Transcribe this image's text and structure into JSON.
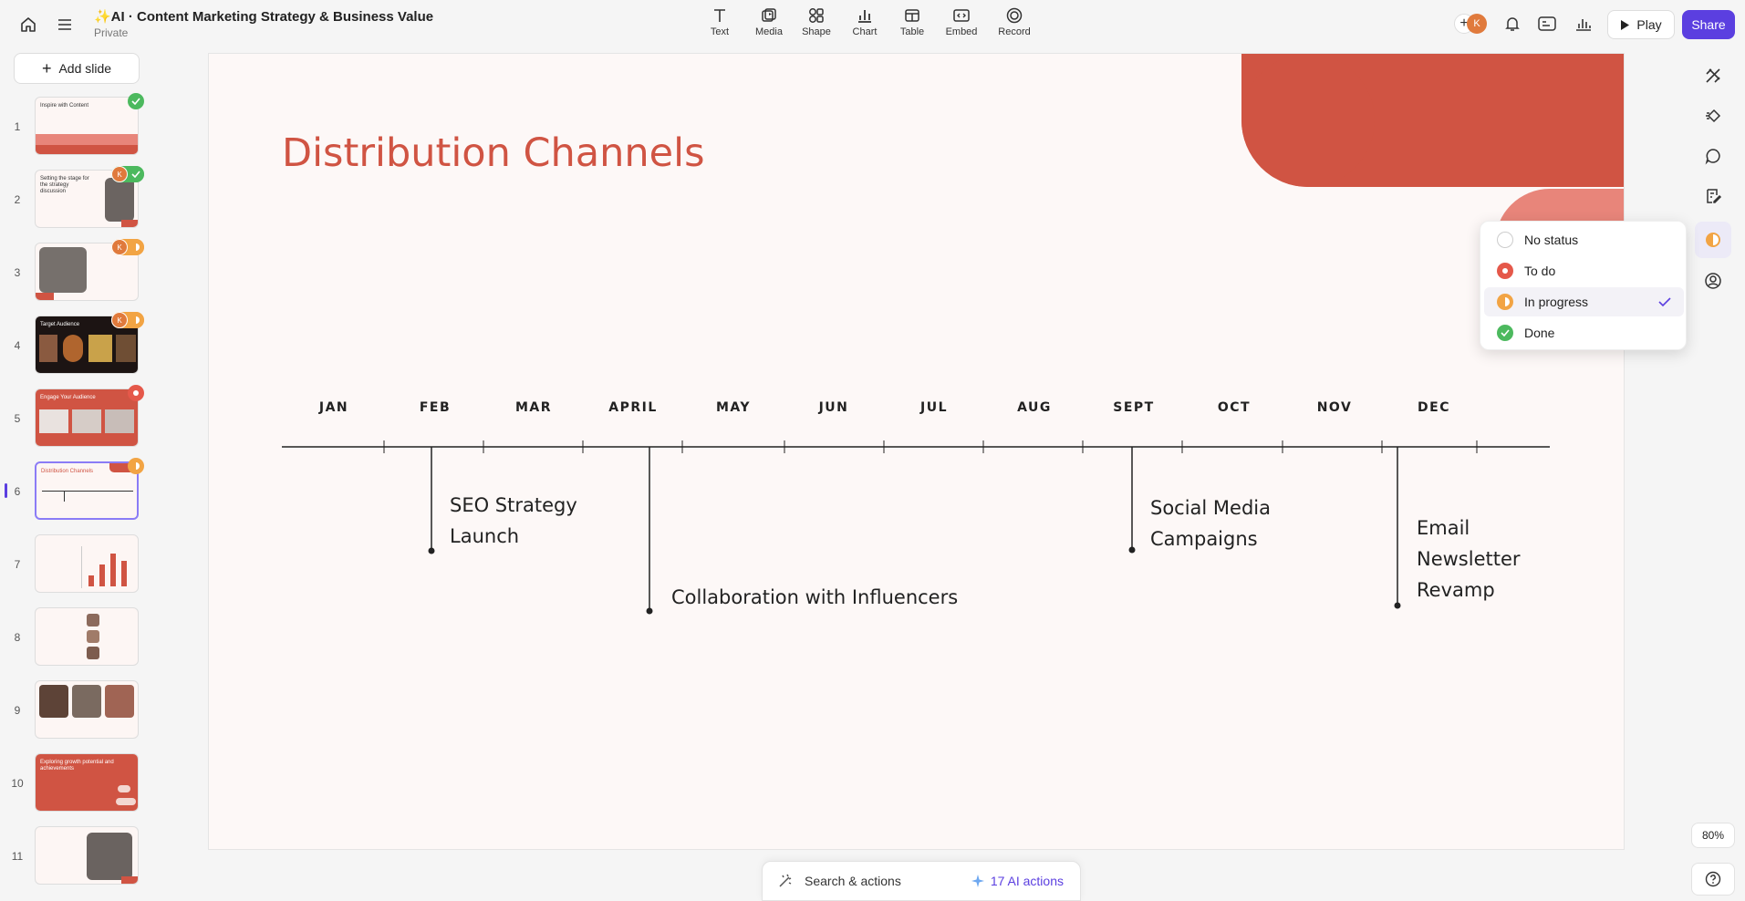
{
  "doc": {
    "title": "✨AI · Content Marketing Strategy & Business Value",
    "visibility": "Private"
  },
  "toolbar": {
    "tools": [
      {
        "label": "Text",
        "icon": "text-icon"
      },
      {
        "label": "Media",
        "icon": "media-icon"
      },
      {
        "label": "Shape",
        "icon": "shape-icon"
      },
      {
        "label": "Chart",
        "icon": "chart-icon"
      },
      {
        "label": "Table",
        "icon": "table-icon"
      },
      {
        "label": "Embed",
        "icon": "embed-icon"
      },
      {
        "label": "Record",
        "icon": "record-icon"
      }
    ],
    "play_label": "Play",
    "share_label": "Share",
    "collaborator_initial": "K"
  },
  "sidebar": {
    "add_slide_label": "Add slide",
    "active_slide": 6,
    "slides": [
      {
        "num": "1",
        "status": "done",
        "avatar": "",
        "title": "Inspire with Content"
      },
      {
        "num": "2",
        "status": "done",
        "avatar": "K",
        "title": "Setting the stage for the strategy discussion"
      },
      {
        "num": "3",
        "status": "in-progress",
        "avatar": "K",
        "title": ""
      },
      {
        "num": "4",
        "status": "in-progress",
        "avatar": "K",
        "title": "Target Audience"
      },
      {
        "num": "5",
        "status": "todo",
        "avatar": "",
        "title": "Engage Your Audience"
      },
      {
        "num": "6",
        "status": "in-progress",
        "avatar": "",
        "title": "Distribution Channels"
      },
      {
        "num": "7",
        "status": "",
        "avatar": "",
        "title": ""
      },
      {
        "num": "8",
        "status": "",
        "avatar": "",
        "title": ""
      },
      {
        "num": "9",
        "status": "",
        "avatar": "",
        "title": ""
      },
      {
        "num": "10",
        "status": "",
        "avatar": "",
        "title": "Exploring growth potential and achievements"
      },
      {
        "num": "11",
        "status": "",
        "avatar": "",
        "title": ""
      }
    ]
  },
  "slide": {
    "title": "Distribution Channels",
    "months": [
      "JAN",
      "FEB",
      "MAR",
      "APRIL",
      "MAY",
      "JUN",
      "JUL",
      "AUG",
      "SEPT",
      "OCT",
      "NOV",
      "DEC"
    ],
    "events": {
      "seo": [
        "SEO Strategy",
        "Launch"
      ],
      "influencers": [
        "Collaboration with Influencers"
      ],
      "social": [
        "Social Media",
        "Campaigns"
      ],
      "email": [
        "Email",
        "Newsletter",
        "Revamp"
      ]
    },
    "colors": {
      "accent": "#d05443",
      "accent_light": "#e8857a",
      "background": "#fdf8f7"
    }
  },
  "status_menu": {
    "items": [
      {
        "label": "No status",
        "key": "none"
      },
      {
        "label": "To do",
        "key": "todo"
      },
      {
        "label": "In progress",
        "key": "in-progress"
      },
      {
        "label": "Done",
        "key": "done"
      }
    ],
    "selected": "In progress"
  },
  "bottom": {
    "search_label": "Search & actions",
    "ai_actions_label": "17 AI actions",
    "zoom_label": "80%"
  },
  "colors": {
    "brand": "#5b3fe0",
    "done": "#4cb95e",
    "todo": "#e5584a",
    "in_progress": "#f2a444"
  }
}
